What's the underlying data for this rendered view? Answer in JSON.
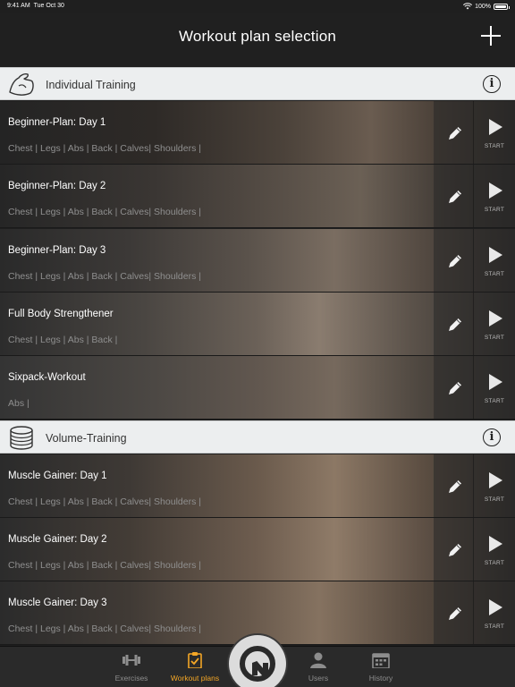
{
  "status_bar": {
    "time": "9:41 AM",
    "date": "Tue Oct 30",
    "battery": "100%"
  },
  "nav": {
    "title": "Workout plan selection"
  },
  "sections": [
    {
      "title": "Individual Training",
      "icon": "flexed-arm-icon"
    },
    {
      "title": "Volume-Training",
      "icon": "weight-plates-icon"
    }
  ],
  "plans": [
    {
      "name": "Beginner-Plan: Day 1",
      "muscles": "Chest | Legs | Abs | Back | Calves| Shoulders |"
    },
    {
      "name": "Beginner-Plan: Day 2",
      "muscles": "Chest | Legs | Abs | Back | Calves| Shoulders |"
    },
    {
      "name": "Beginner-Plan: Day 3",
      "muscles": "Chest | Legs | Abs | Back | Calves| Shoulders |"
    },
    {
      "name": "Full Body Strengthener",
      "muscles": "Chest | Legs | Abs | Back |"
    },
    {
      "name": "Sixpack-Workout",
      "muscles": "Abs |"
    },
    {
      "name": "Muscle Gainer: Day 1",
      "muscles": "Chest | Legs | Abs | Back | Calves| Shoulders |"
    },
    {
      "name": "Muscle Gainer: Day 2",
      "muscles": "Chest | Legs | Abs | Back | Calves| Shoulders |"
    },
    {
      "name": "Muscle Gainer: Day 3",
      "muscles": "Chest | Legs | Abs | Back | Calves| Shoulders |"
    }
  ],
  "start_label": "START",
  "tabs": [
    {
      "label": "Exercises",
      "icon": "dumbbell-icon"
    },
    {
      "label": "Workout plans",
      "icon": "clipboard-check-icon",
      "active": true
    },
    {
      "label": "Users",
      "icon": "user-icon"
    },
    {
      "label": "History",
      "icon": "calendar-icon"
    }
  ],
  "colors": {
    "accent": "#f3a626",
    "header_bg": "#202020",
    "section_bg": "#eceeef",
    "tab_bg": "#2a2a2a"
  }
}
